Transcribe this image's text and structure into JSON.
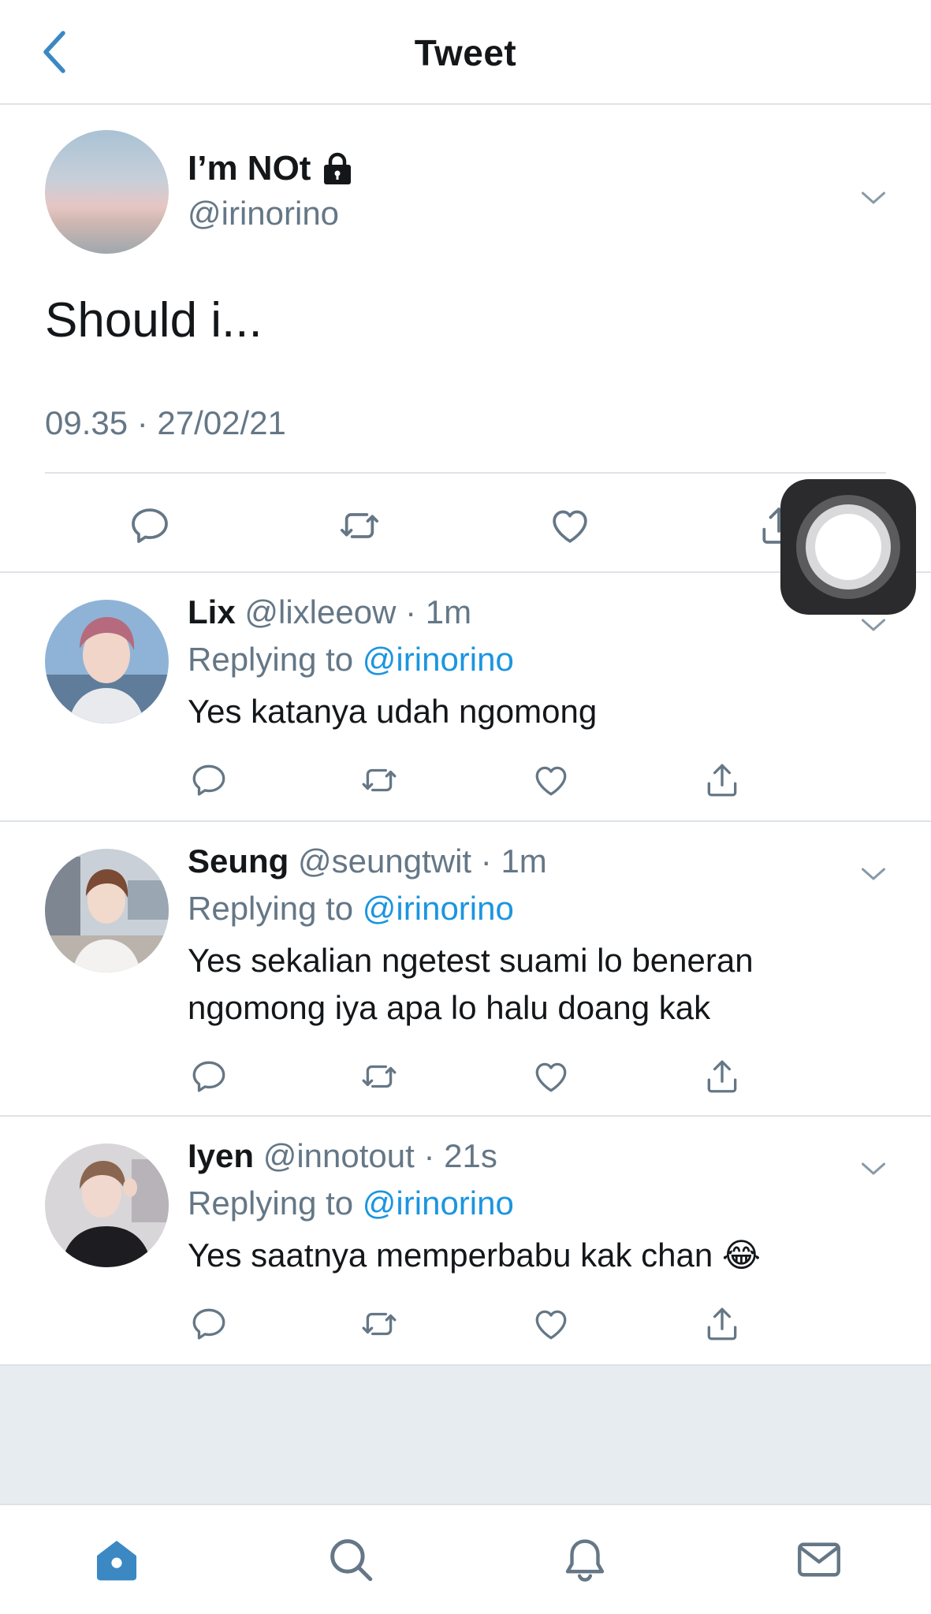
{
  "header": {
    "title": "Tweet"
  },
  "main_tweet": {
    "name": "I’m NOt",
    "handle": "@irinorino",
    "text": "Should i...",
    "timestamp": "09.35 · 27/02/21"
  },
  "replies": [
    {
      "name": "Lix",
      "handle": "@lixleeow",
      "dot": "·",
      "time": "1m",
      "replying_prefix": "Replying to",
      "replying_to": "@irinorino",
      "text": "Yes katanya udah ngomong"
    },
    {
      "name": "Seung",
      "handle": "@seungtwit",
      "dot": "·",
      "time": "1m",
      "replying_prefix": "Replying to",
      "replying_to": "@irinorino",
      "text": "Yes sekalian ngetest suami lo beneran ngomong iya apa lo halu doang kak"
    },
    {
      "name": "Iyen",
      "handle": "@innotout",
      "dot": "·",
      "time": "21s",
      "replying_prefix": "Replying to",
      "replying_to": "@irinorino",
      "text": "Yes saatnya memperbabu kak chan 😂"
    }
  ],
  "colors": {
    "accent": "#1b95e0",
    "secondary_text": "#657786",
    "divider": "#dfe3e7",
    "icon": "#657786",
    "home_active": "#3b88c3"
  },
  "icons": [
    "back-icon",
    "lock-icon",
    "chevron-down-icon",
    "reply-icon",
    "retweet-icon",
    "like-icon",
    "share-icon",
    "home-icon",
    "search-icon",
    "notifications-icon",
    "messages-icon",
    "assistive-touch-icon"
  ]
}
